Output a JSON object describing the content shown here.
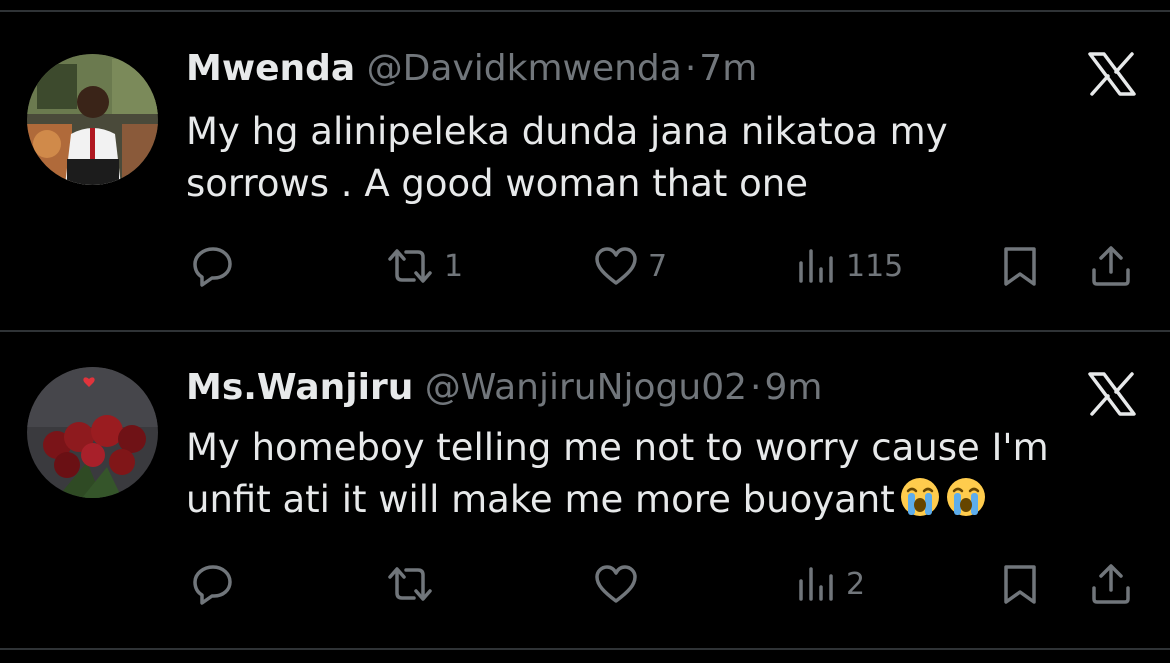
{
  "colors": {
    "background": "#000000",
    "primary_text": "#e7e9ea",
    "secondary_text": "#71767b",
    "divider": "#2f3336"
  },
  "tweets": [
    {
      "display_name": "Mwenda",
      "handle": "@Davidkmwenda",
      "separator": "·",
      "time": "7m",
      "text_lines": [
        "My hg alinipeleka dunda jana nikatoa my",
        "sorrows . A good woman that one"
      ],
      "emoji": [],
      "avatar": "man-in-white-shirt-red-tie-photo",
      "replies": "",
      "reposts": "1",
      "likes": "7",
      "views": "115"
    },
    {
      "display_name": "Ms.Wanjiru",
      "handle": "@WanjiruNjogu02",
      "separator": "·",
      "time": "9m",
      "text_lines": [
        "My homeboy telling me not to worry cause I'm",
        "unfit ati it will make me more buoyant"
      ],
      "emoji": [
        "loudly-crying-face-emoji",
        "loudly-crying-face-emoji"
      ],
      "avatar": "red-roses-photo",
      "replies": "",
      "reposts": "",
      "likes": "",
      "views": "2"
    }
  ],
  "icons": {
    "close": "x-logo-icon",
    "reply": "reply-icon",
    "repost": "repost-icon",
    "like": "heart-icon",
    "views": "views-bar-chart-icon",
    "bookmark": "bookmark-icon",
    "share": "share-icon"
  }
}
